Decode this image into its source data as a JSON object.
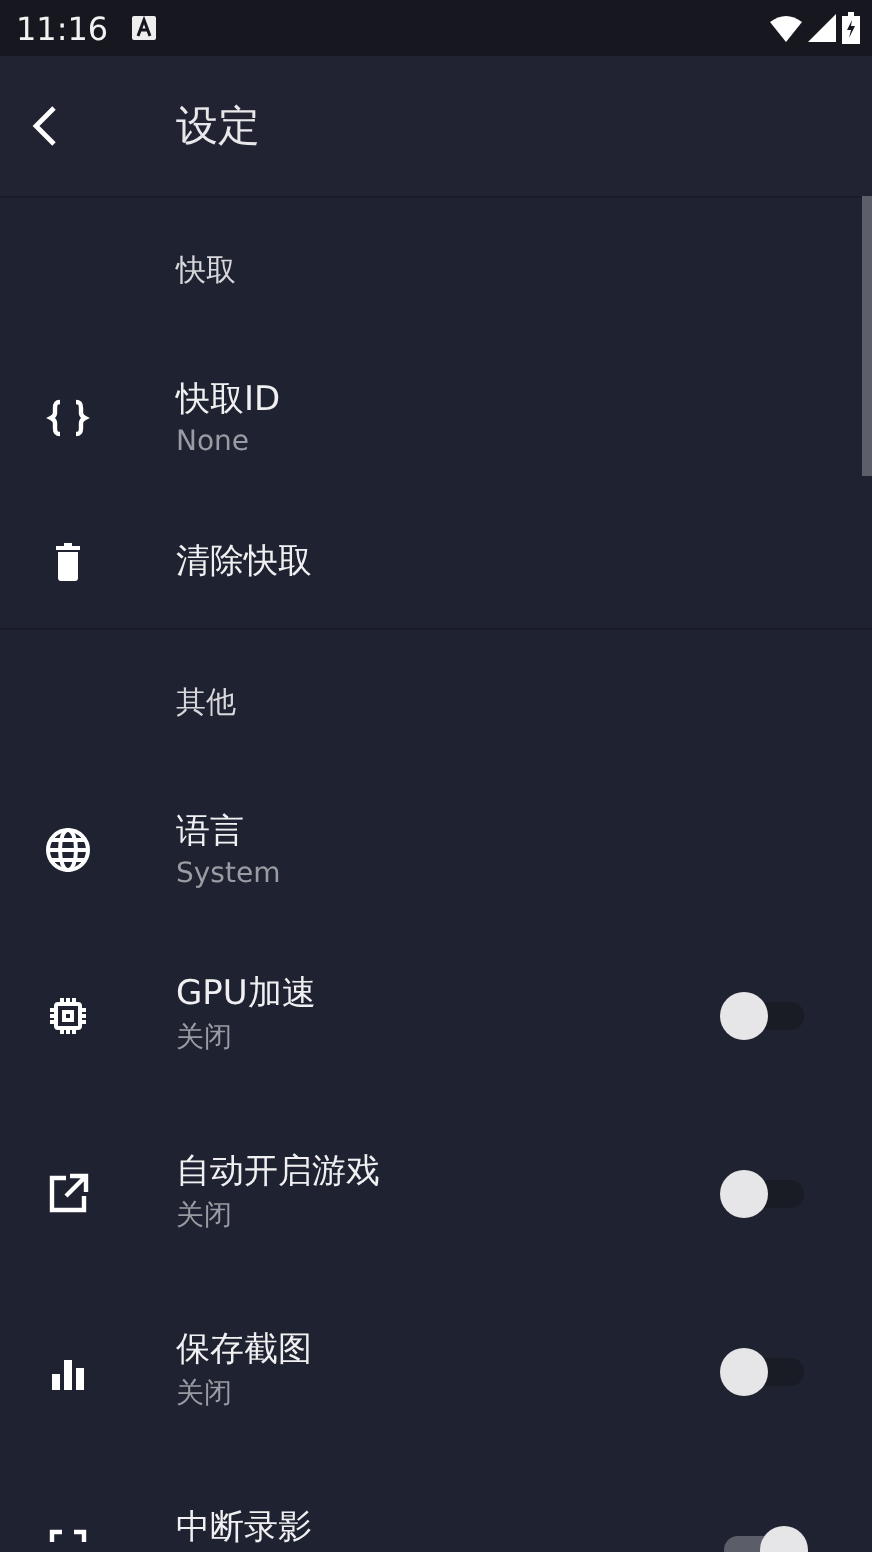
{
  "status_bar": {
    "time": "11:16"
  },
  "app_bar": {
    "title": "设定"
  },
  "sections": [
    {
      "header": "快取",
      "items": [
        {
          "kind": "plain",
          "title": "快取ID",
          "subtitle": "None"
        },
        {
          "kind": "plain",
          "title": "清除快取"
        }
      ]
    },
    {
      "header": "其他",
      "items": [
        {
          "kind": "plain",
          "title": "语言",
          "subtitle": "System"
        },
        {
          "kind": "toggle",
          "title": "GPU加速",
          "subtitle": "关闭",
          "on": false
        },
        {
          "kind": "toggle",
          "title": "自动开启游戏",
          "subtitle": "关闭",
          "on": false
        },
        {
          "kind": "toggle",
          "title": "保存截图",
          "subtitle": "关闭",
          "on": false
        },
        {
          "kind": "toggle",
          "title": "中断录影",
          "on": true
        }
      ]
    }
  ]
}
